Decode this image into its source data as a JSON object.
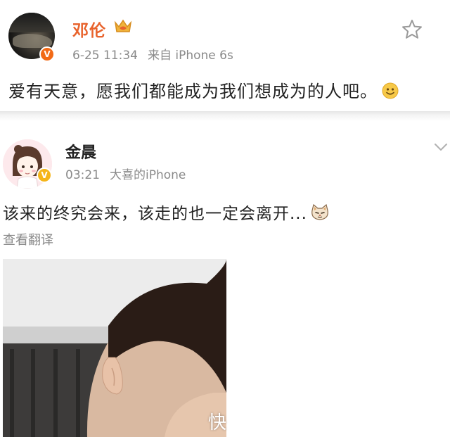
{
  "post1": {
    "author": "邓伦",
    "verified_badge": "V",
    "time": "6-25 11:34",
    "source": "来自 iPhone 6s",
    "text": "爱有天意，愿我们都能成为我们想成为的人吧。",
    "emoji": "smile-emoji",
    "crown_icon": "crown-icon",
    "badge_color": "#f26a16",
    "name_color": "#e8632c"
  },
  "post2": {
    "author": "金晨",
    "verified_badge": "V",
    "time": "03:21",
    "source": "大喜的iPhone",
    "text": "该来的终究会来，该走的也一定会离开...",
    "emoji": "cat-emoji",
    "translate_label": "查看翻译",
    "badge_color": "#f5b51a"
  },
  "watermark": "快"
}
